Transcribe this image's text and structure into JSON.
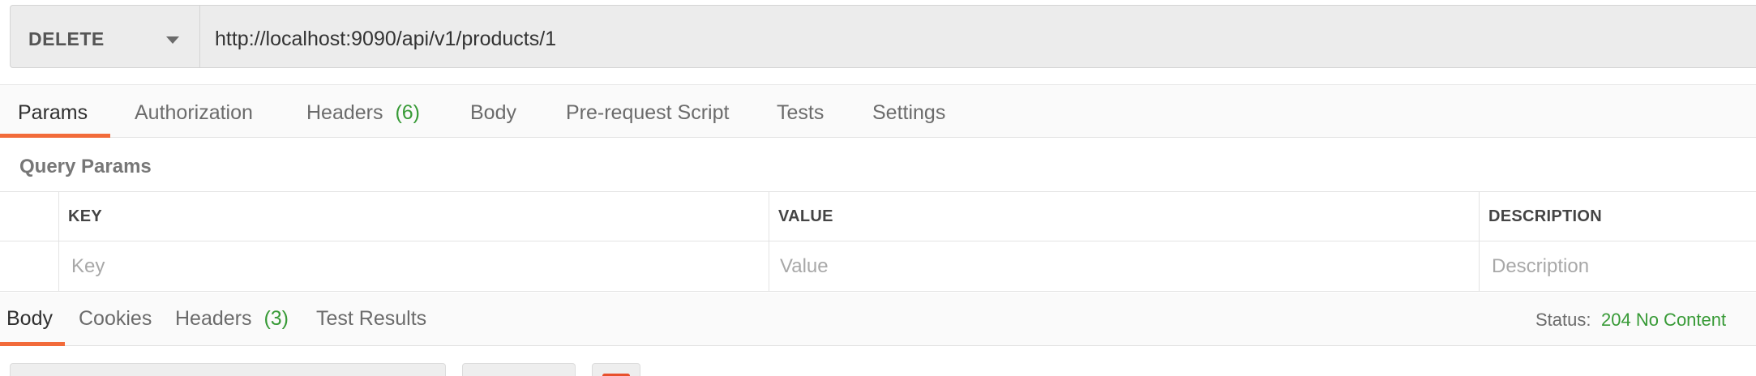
{
  "request": {
    "method": "DELETE",
    "url": "http://localhost:9090/api/v1/products/1"
  },
  "request_tabs": [
    {
      "label": "Params",
      "count": "",
      "active": true
    },
    {
      "label": "Authorization",
      "count": "",
      "active": false
    },
    {
      "label": "Headers",
      "count": "(6)",
      "active": false
    },
    {
      "label": "Body",
      "count": "",
      "active": false
    },
    {
      "label": "Pre-request Script",
      "count": "",
      "active": false
    },
    {
      "label": "Tests",
      "count": "",
      "active": false
    },
    {
      "label": "Settings",
      "count": "",
      "active": false
    }
  ],
  "query_params": {
    "title": "Query Params",
    "columns": [
      "KEY",
      "VALUE",
      "DESCRIPTION"
    ],
    "placeholders": [
      "Key",
      "Value",
      "Description"
    ]
  },
  "response_tabs": [
    {
      "label": "Body",
      "count": "",
      "active": true
    },
    {
      "label": "Cookies",
      "count": "",
      "active": false
    },
    {
      "label": "Headers",
      "count": "(3)",
      "active": false
    },
    {
      "label": "Test Results",
      "count": "",
      "active": false
    }
  ],
  "response_status": {
    "label": "Status:",
    "value": "204 No Content"
  },
  "colors": {
    "accent": "#f26b3a",
    "success": "#379a36"
  }
}
